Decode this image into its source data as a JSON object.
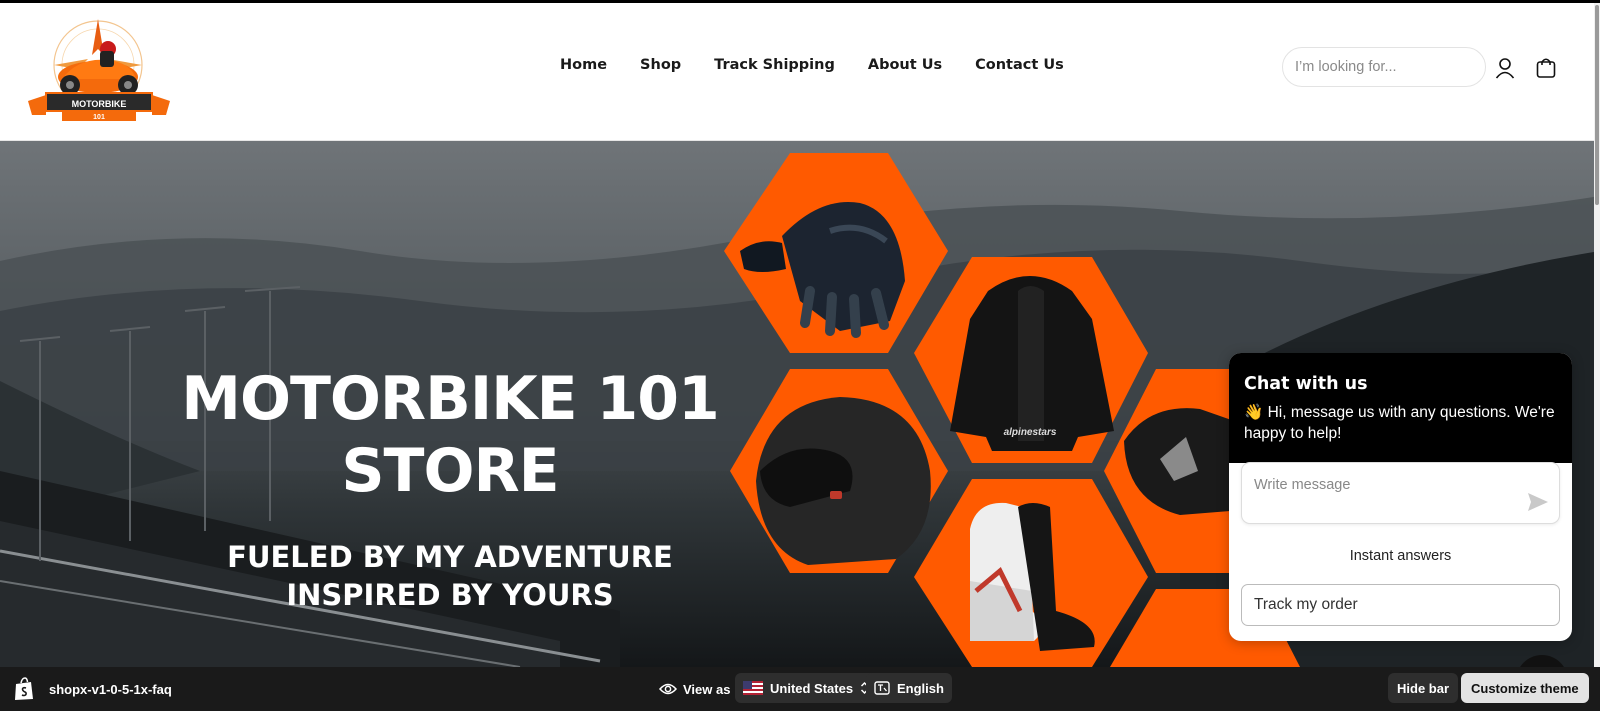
{
  "header": {
    "logo_text": "MOTORBIKE",
    "logo_number": "101",
    "nav": [
      {
        "label": "Home"
      },
      {
        "label": "Shop"
      },
      {
        "label": "Track Shipping"
      },
      {
        "label": "About Us"
      },
      {
        "label": "Contact Us"
      }
    ],
    "search": {
      "placeholder": "I’m looking for..."
    },
    "icons": [
      "account-icon",
      "cart-icon"
    ]
  },
  "hero": {
    "title_line1": "MOTORBIKE 101",
    "title_line2": "STORE",
    "subtitle_line1": "FUELED BY MY ADVENTURE",
    "subtitle_line2": "INSPIRED BY YOURS",
    "jacket_brand": "alpinestars",
    "accent_color": "#ff5a00"
  },
  "chat": {
    "title": "Chat with us",
    "greeting": "👋 Hi, message us with any questions. We're happy to help!",
    "input_placeholder": "Write message",
    "instant_answers": "Instant answers",
    "track_button": "Track my order"
  },
  "admin_bar": {
    "store_name": "shopx-v1-0-5-1x-faq",
    "view_as": "View as",
    "country": "United States",
    "language": "English",
    "hide_bar": "Hide bar",
    "customize_theme": "Customize theme"
  }
}
